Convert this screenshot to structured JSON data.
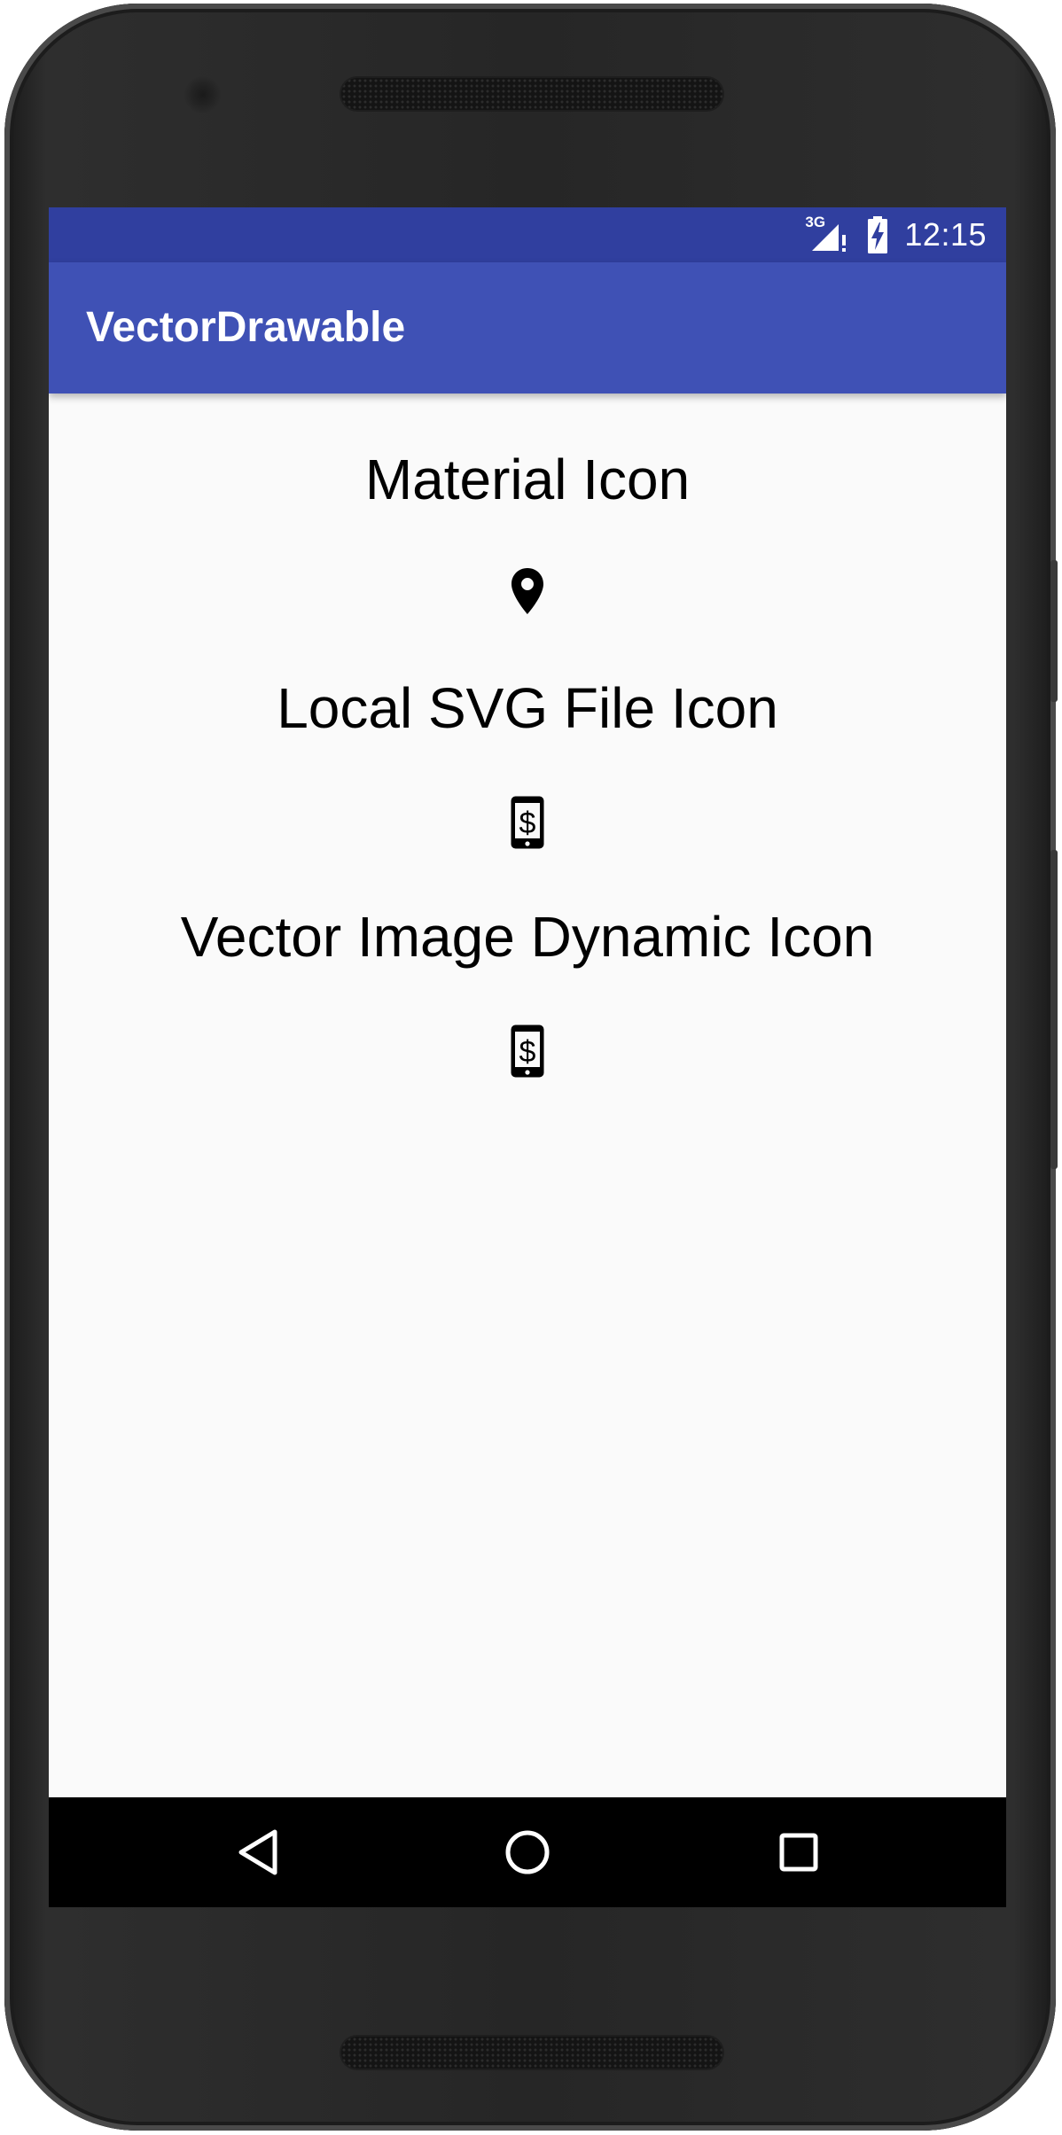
{
  "status_bar": {
    "network_label": "3G",
    "time": "12:15",
    "icons": [
      "signal-icon",
      "battery-charging-icon"
    ]
  },
  "app_bar": {
    "title": "VectorDrawable"
  },
  "main": {
    "sections": [
      {
        "label": "Material Icon",
        "icon": "location-pin-icon"
      },
      {
        "label": "Local SVG File Icon",
        "icon": "phone-dollar-icon"
      },
      {
        "label": "Vector Image Dynamic Icon",
        "icon": "phone-dollar-icon"
      }
    ]
  },
  "nav_bar": {
    "buttons": [
      "back-icon",
      "home-icon",
      "recents-icon"
    ]
  },
  "colors": {
    "status_bar": "#303f9f",
    "app_bar": "#3f51b5",
    "background": "#fafafa",
    "nav_bar": "#000000"
  }
}
